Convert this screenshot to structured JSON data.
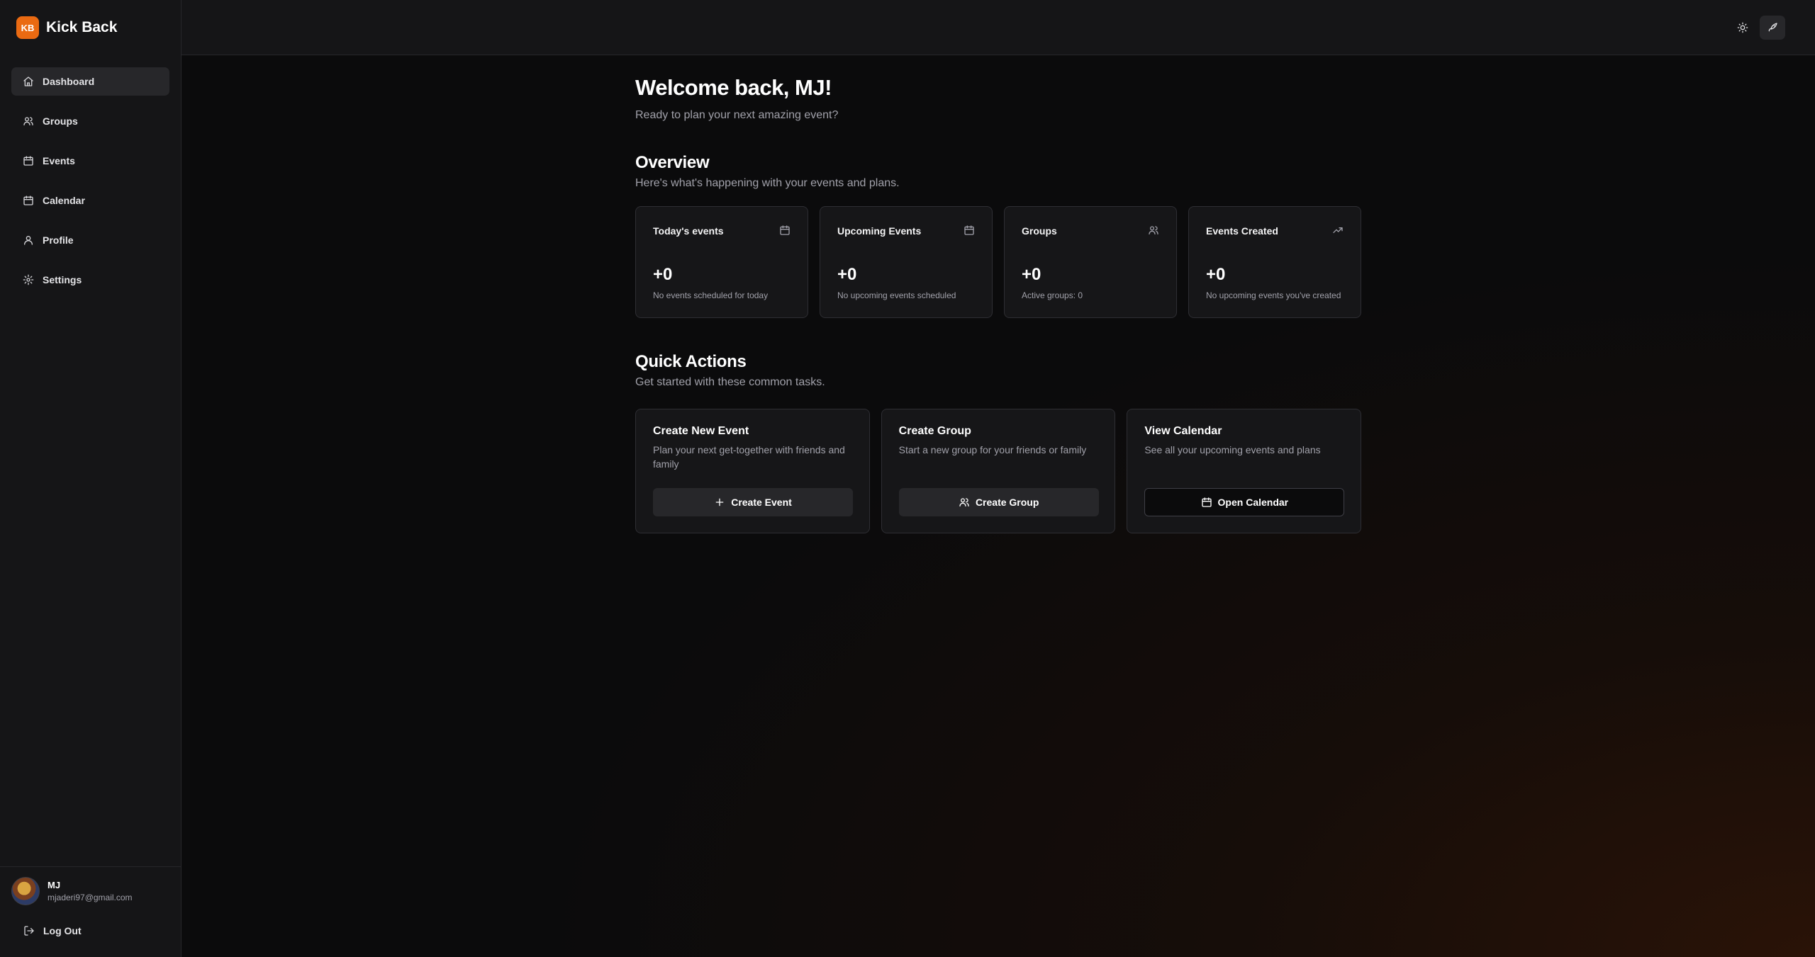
{
  "app": {
    "logo_text": "KB",
    "name": "Kick Back"
  },
  "sidebar": {
    "items": [
      {
        "label": "Dashboard",
        "icon": "home-icon",
        "active": true
      },
      {
        "label": "Groups",
        "icon": "users-icon",
        "active": false
      },
      {
        "label": "Events",
        "icon": "calendar-icon",
        "active": false
      },
      {
        "label": "Calendar",
        "icon": "calendar-icon",
        "active": false
      },
      {
        "label": "Profile",
        "icon": "user-icon",
        "active": false
      },
      {
        "label": "Settings",
        "icon": "gear-icon",
        "active": false
      }
    ],
    "user": {
      "name": "MJ",
      "email": "mjaderi97@gmail.com"
    },
    "logout_label": "Log Out"
  },
  "topbar": {
    "theme_icon": "sun-icon",
    "launch_icon": "rocket-icon"
  },
  "main": {
    "welcome_title": "Welcome back, MJ!",
    "welcome_sub": "Ready to plan your next amazing event?",
    "overview_title": "Overview",
    "overview_sub": "Here's what's happening with your events and plans.",
    "stats": [
      {
        "title": "Today's events",
        "icon": "calendar-icon",
        "value": "+0",
        "desc": "No events scheduled for today"
      },
      {
        "title": "Upcoming Events",
        "icon": "calendar-icon",
        "value": "+0",
        "desc": "No upcoming events scheduled"
      },
      {
        "title": "Groups",
        "icon": "users-icon",
        "value": "+0",
        "desc": "Active groups: 0"
      },
      {
        "title": "Events Created",
        "icon": "trending-up-icon",
        "value": "+0",
        "desc": "No upcoming events you've created"
      }
    ],
    "quick_actions_title": "Quick Actions",
    "quick_actions_sub": "Get started with these common tasks.",
    "actions": [
      {
        "title": "Create New Event",
        "desc": "Plan your next get-together with friends and family",
        "button": "Create Event",
        "icon": "plus-icon"
      },
      {
        "title": "Create Group",
        "desc": "Start a new group for your friends or family",
        "button": "Create Group",
        "icon": "users-icon"
      },
      {
        "title": "View Calendar",
        "desc": "See all your upcoming events and plans",
        "button": "Open Calendar",
        "icon": "calendar-icon"
      }
    ]
  },
  "colors": {
    "accent": "#ea6a12",
    "background": "#0b0b0c",
    "surface": "#161618",
    "border": "#2e2e33"
  }
}
